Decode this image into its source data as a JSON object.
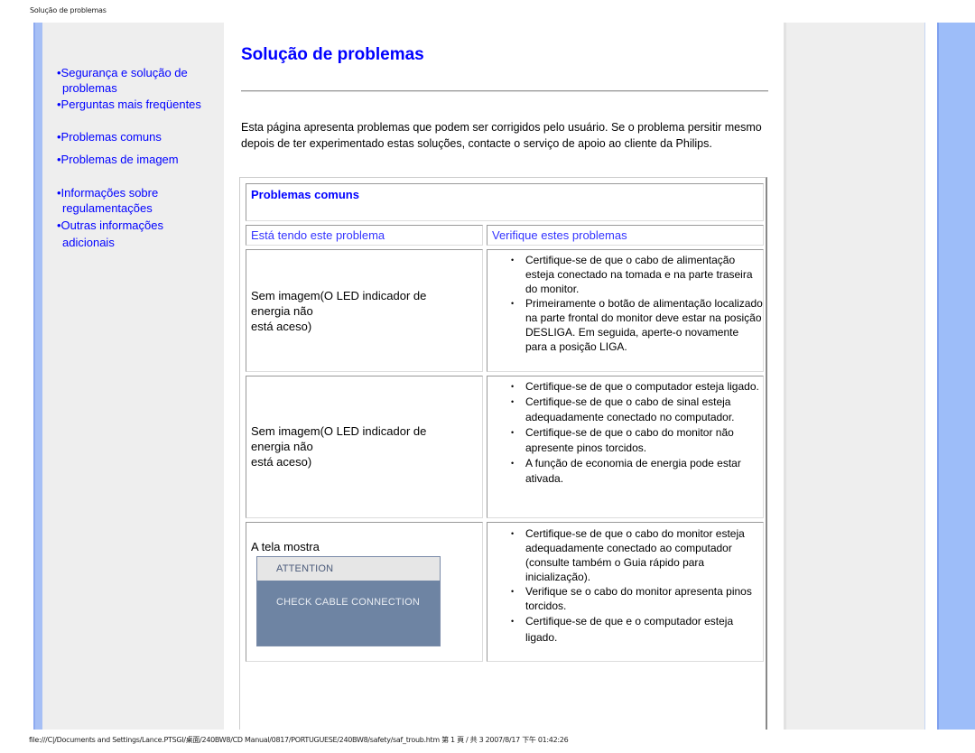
{
  "browser": {
    "header_title": "Solução de problemas",
    "footer": "file:///C|/Documents and Settings/Lance.PTSGI/桌面/240BW8/CD Manual/0817/PORTUGUESE/240BW8/safety/saf_troub.htm 第 1 頁 / 共 3 2007/8/17 下午 01:42:26"
  },
  "sidebar": {
    "items": [
      {
        "line1": "•Segurança e solução de",
        "line2": "problemas"
      },
      {
        "line1": "•Perguntas mais freqüentes"
      },
      {
        "line1": "•Problemas comuns"
      },
      {
        "line1": "•Problemas de imagem"
      },
      {
        "line1": "•Informações sobre",
        "line2": "regulamentações"
      },
      {
        "line1": "•Outras informações",
        "line2": "adicionais"
      }
    ]
  },
  "main": {
    "title": "Solução de problemas",
    "intro": "Esta página apresenta problemas que podem ser corrigidos pelo usuário. Se o problema persitir mesmo depois de ter experimentado estas soluções, contacte o serviço de apoio ao cliente da Philips.",
    "section_title": "Problemas comuns",
    "col_problem": "Está tendo este problema",
    "col_check": "Verifique estes problemas",
    "rows": [
      {
        "problem_lines": [
          "Sem imagem(O LED indicador de",
          "energia não",
          "está aceso)"
        ],
        "checks": [
          "Certifique-se de que o cabo de alimentação esteja conectado na tomada e na parte traseira do monitor.",
          "Primeiramente o botão de alimentação localizado na parte frontal do monitor deve estar na posição DESLIGA. Em seguida, aperte-o novamente para a posição LIGA."
        ]
      },
      {
        "problem_lines": [
          "Sem imagem(O LED indicador de",
          "energia não",
          "está aceso)"
        ],
        "checks": [
          "Certifique-se de que o computador esteja ligado.",
          "Certifique-se de que o cabo de sinal esteja adequadamente conectado no computador.",
          "Certifique-se de que o cabo do monitor não apresente pinos torcidos.",
          "A função de economia de energia pode estar ativada."
        ]
      },
      {
        "problem_lines": [
          "A tela mostra"
        ],
        "osd": {
          "header": "ATTENTION",
          "message": "CHECK CABLE CONNECTION"
        },
        "checks": [
          "Certifique-se de que o cabo do monitor esteja adequadamente conectado ao computador (consulte também o Guia rápido para inicialização).",
          "Verifique se o cabo do monitor apresenta pinos torcidos.",
          "Certifique-se de que e o computador esteja ligado."
        ]
      }
    ]
  },
  "colors": {
    "link": "#0000ff",
    "side_bar": "#a6bff5",
    "panel_gray": "#eeeeee",
    "osd_body": "#6e84a3"
  }
}
